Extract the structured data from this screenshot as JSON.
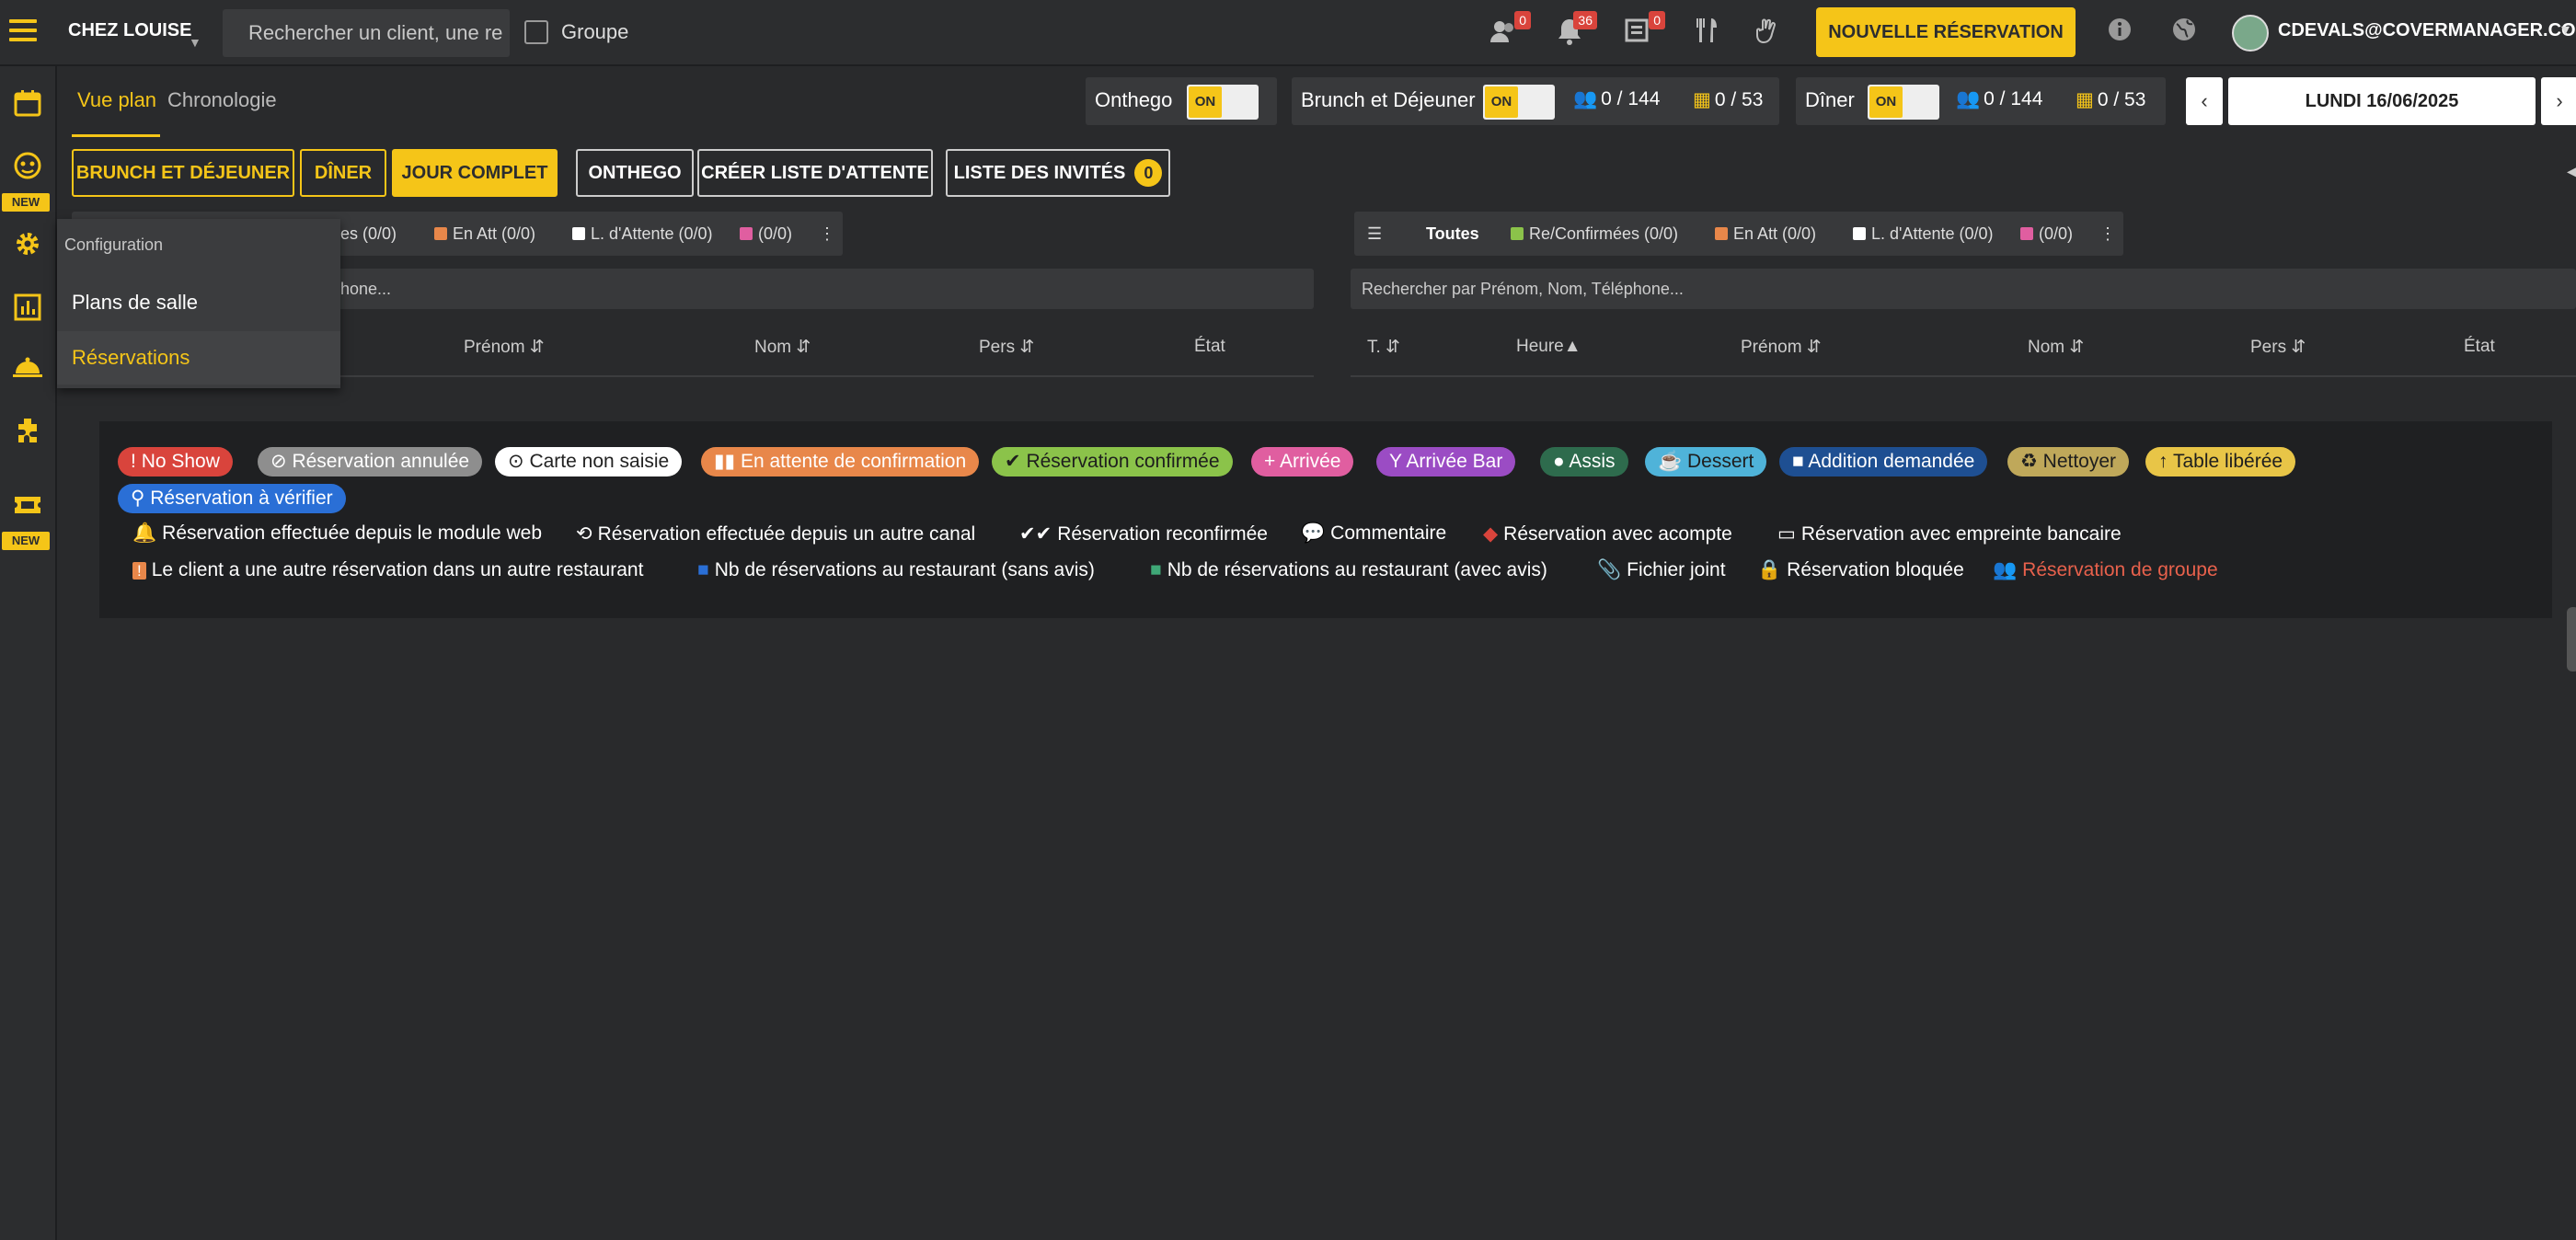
{
  "header": {
    "restaurant": "CHEZ LOUISE",
    "search_placeholder": "Rechercher un client, une re",
    "group_label": "Groupe",
    "badges": {
      "guests": "0",
      "notifications": "36",
      "messages": "0"
    },
    "new_reservation": "NOUVELLE RÉSERVATION",
    "user_email": "CDEVALS@COVERMANAGER.COM"
  },
  "rail": {
    "new_label": "NEW"
  },
  "flyout": {
    "title": "Configuration",
    "items": [
      "Plans de salle",
      "Réservations"
    ]
  },
  "view_tabs": {
    "plan": "Vue plan",
    "chrono": "Chronologie"
  },
  "services": {
    "onthego": {
      "label": "Onthego",
      "toggle": "ON"
    },
    "brunch": {
      "label": "Brunch et Déjeuner",
      "toggle": "ON",
      "covers": "0 / 144",
      "tables": "0 / 53"
    },
    "diner": {
      "label": "Dîner",
      "toggle": "ON",
      "covers": "0 / 144",
      "tables": "0 / 53"
    }
  },
  "date": {
    "label": "LUNDI 16/06/2025",
    "prev": "‹",
    "next": "›"
  },
  "actions": {
    "brunch": "BRUNCH ET DÉJEUNER",
    "diner": "DÎNER",
    "full_day": "JOUR COMPLET",
    "onthego": "ONTHEGO",
    "waitlist": "CRÉER LISTE D'ATTENTE",
    "guest_list": "LISTE DES INVITÉS",
    "guest_count": "0"
  },
  "left_table": {
    "filters": [
      "ées (0/0)",
      "En Att (0/0)",
      "L. d'Attente (0/0)",
      "(0/0)"
    ],
    "search": "phone...",
    "columns": [
      "Prénom",
      "Nom",
      "Pers",
      "État"
    ]
  },
  "right_table": {
    "filters": [
      "Toutes",
      "Re/Confirmées (0/0)",
      "En Att (0/0)",
      "L. d'Attente (0/0)",
      "(0/0)"
    ],
    "search": "Rechercher par Prénom, Nom, Téléphone...",
    "columns": [
      "T.",
      "Heure",
      "Prénom",
      "Nom",
      "Pers",
      "État"
    ]
  },
  "legend": {
    "badges": [
      {
        "label": "No Show",
        "icon": "!",
        "bg": "#d9443c",
        "fg": "#ffffff"
      },
      {
        "label": "Réservation annulée",
        "icon": "⊘",
        "bg": "#8e8e8e",
        "fg": "#ffffff"
      },
      {
        "label": "Carte non saisie",
        "icon": "⊙",
        "bg": "#ffffff",
        "fg": "#222222"
      },
      {
        "label": "En attente de confirmation",
        "icon": "▮▮",
        "bg": "#e8874a",
        "fg": "#ffffff"
      },
      {
        "label": "Réservation confirmée",
        "icon": "✔",
        "bg": "#8bc34a",
        "fg": "#1e1e1e"
      },
      {
        "label": "Arrivée",
        "icon": "+",
        "bg": "#e05ea0",
        "fg": "#ffffff"
      },
      {
        "label": "Arrivée Bar",
        "icon": "Y",
        "bg": "#9b4cc4",
        "fg": "#ffffff"
      },
      {
        "label": "Assis",
        "icon": "●",
        "bg": "#2e6b4d",
        "fg": "#ffffff"
      },
      {
        "label": "Dessert",
        "icon": "☕",
        "bg": "#4fb3d9",
        "fg": "#1e1e1e"
      },
      {
        "label": "Addition demandée",
        "icon": "■",
        "bg": "#1e4f92",
        "fg": "#ffffff"
      },
      {
        "label": "Nettoyer",
        "icon": "♻",
        "bg": "#bfa85a",
        "fg": "#1e1e1e"
      },
      {
        "label": "Table libérée",
        "icon": "↑",
        "bg": "#e8c547",
        "fg": "#1e1e1e"
      },
      {
        "label": "Réservation à vérifier",
        "icon": "⚲",
        "bg": "#2a6fd6",
        "fg": "#ffffff"
      }
    ],
    "row3": [
      {
        "label": "Réservation effectuée depuis le module web",
        "icon": "🔔"
      },
      {
        "label": "Réservation effectuée depuis un autre canal",
        "icon": "⟲"
      },
      {
        "label": "Réservation reconfirmée",
        "icon": "✔✔"
      },
      {
        "label": "Commentaire",
        "icon": "💬"
      },
      {
        "label": "Réservation avec acompte",
        "icon": "◆"
      },
      {
        "label": "Réservation avec empreinte bancaire",
        "icon": "▭"
      }
    ],
    "row4": [
      {
        "label": "Le client a une autre réservation dans un autre restaurant",
        "icon": "!"
      },
      {
        "label": "Nb de réservations au restaurant (sans avis)",
        "icon": "■"
      },
      {
        "label": "Nb de réservations au restaurant (avec avis)",
        "icon": "■"
      },
      {
        "label": "Fichier joint",
        "icon": "📎"
      },
      {
        "label": "Réservation bloquée",
        "icon": "🔒"
      },
      {
        "label": "Réservation de groupe",
        "icon": "👥"
      }
    ]
  },
  "colors": {
    "accent": "#f5c518",
    "background": "#292a2c",
    "group_text": "#e8614c"
  }
}
